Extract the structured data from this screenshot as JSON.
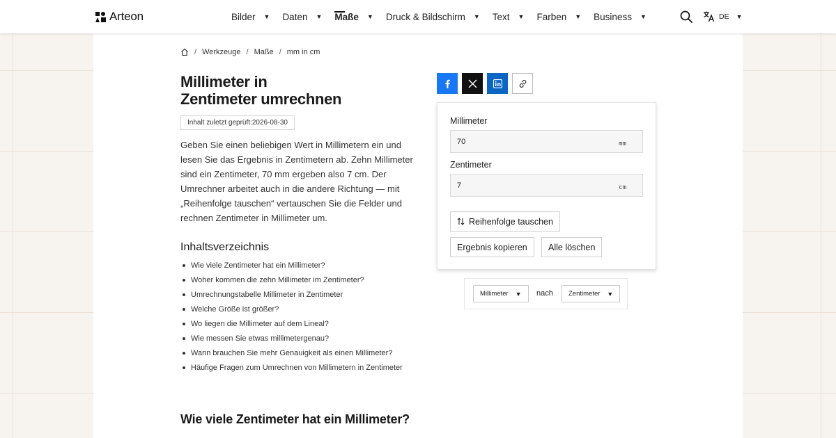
{
  "brand": {
    "name": "Arteon"
  },
  "nav": {
    "items": [
      {
        "label": "Bilder",
        "active": false
      },
      {
        "label": "Daten",
        "active": false
      },
      {
        "label": "Maße",
        "active": true
      },
      {
        "label": "Druck & Bildschirm",
        "active": false
      },
      {
        "label": "Text",
        "active": false
      },
      {
        "label": "Farben",
        "active": false
      },
      {
        "label": "Business",
        "active": false
      }
    ],
    "caret": "▼"
  },
  "header": {
    "search_icon": "search-icon",
    "lang_icon": "translate-icon",
    "lang_code": "DE"
  },
  "breadcrumb": {
    "home_icon": "home-icon",
    "sep": "/",
    "items": [
      "Werkzeuge",
      "Maße",
      "mm in cm"
    ]
  },
  "page": {
    "title_line1": "Millimeter in",
    "title_line2": "Zentimeter umrechnen",
    "review_badge": "Inhalt zuletzt geprüft:2026-08-30",
    "intro": "Geben Sie einen beliebigen Wert in Millimetern ein und lesen Sie das Ergebnis in Zentimetern ab. Zehn Millimeter sind ein Zentimeter, 70 mm ergeben also 7 cm. Der Umrechner arbeitet auch in die andere Richtung — mit „Reihenfolge tauschen“ vertauschen Sie die Felder und rechnen Zentimeter in Millimeter um."
  },
  "toc": {
    "heading": "Inhaltsverzeichnis",
    "items": [
      "Wie viele Zentimeter hat ein Millimeter?",
      "Woher kommen die zehn Millimeter im Zentimeter?",
      "Umrechnungstabelle Millimeter in Zentimeter",
      "Welche Größe ist größer?",
      "Wo liegen die Millimeter auf dem Lineal?",
      "Wie messen Sie etwas millimetergenau?",
      "Wann brauchen Sie mehr Genauigkeit als einen Millimeter?",
      "Häufige Fragen zum Umrechnen von Millimetern in Zentimeter"
    ]
  },
  "section": {
    "heading": "Wie viele Zentimeter hat ein Millimeter?"
  },
  "share": {
    "icons": [
      "facebook-icon",
      "x-icon",
      "linkedin-icon",
      "link-icon"
    ],
    "colors": {
      "facebook": "#1877f2",
      "x": "#111111",
      "linkedin": "#0a66c2"
    }
  },
  "converter": {
    "from_label": "Millimeter",
    "from_value": "70",
    "from_unit": "mm",
    "to_label": "Zentimeter",
    "to_value": "7",
    "to_unit": "cm",
    "swap_label": "Reihenfolge tauschen",
    "copy_label": "Ergebnis kopieren",
    "clear_label": "Alle löschen"
  },
  "unit_select": {
    "from": "Millimeter",
    "connector": "nach",
    "to": "Zentimeter"
  }
}
